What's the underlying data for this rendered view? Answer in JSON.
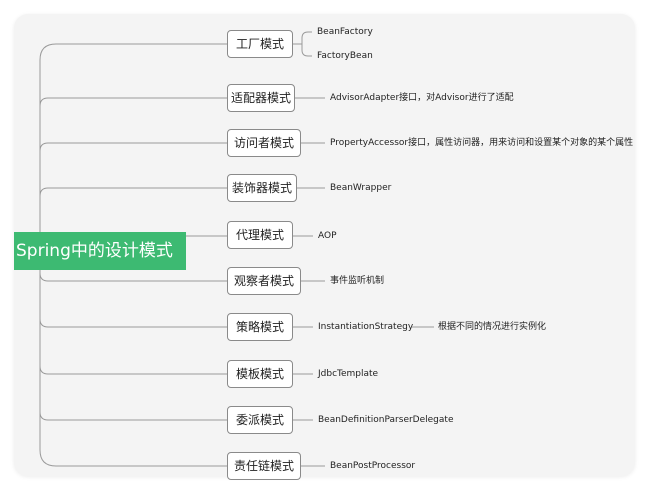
{
  "root": {
    "label": "Spring中的设计模式"
  },
  "patterns": [
    {
      "label": "工厂模式",
      "leaves": [
        "BeanFactory",
        "FactoryBean"
      ]
    },
    {
      "label": "适配器模式",
      "leaves": [
        "AdvisorAdapter接口，对Advisor进行了适配"
      ]
    },
    {
      "label": "访问者模式",
      "leaves": [
        "PropertyAccessor接口，属性访问器，用来访问和设置某个对象的某个属性"
      ]
    },
    {
      "label": "装饰器模式",
      "leaves": [
        "BeanWrapper"
      ]
    },
    {
      "label": "代理模式",
      "leaves": [
        "AOP"
      ]
    },
    {
      "label": "观察者模式",
      "leaves": [
        "事件监听机制"
      ]
    },
    {
      "label": "策略模式",
      "leaves": [
        "InstantiationStrategy",
        "根据不同的情况进行实例化"
      ]
    },
    {
      "label": "模板模式",
      "leaves": [
        "JdbcTemplate"
      ]
    },
    {
      "label": "委派模式",
      "leaves": [
        "BeanDefinitionParserDelegate"
      ]
    },
    {
      "label": "责任链模式",
      "leaves": [
        "BeanPostProcessor"
      ]
    }
  ],
  "colors": {
    "root_fill": "#3dba72",
    "line": "#9a9a9a",
    "node_border": "#8a8a8a",
    "background": "#f4f4f4"
  }
}
